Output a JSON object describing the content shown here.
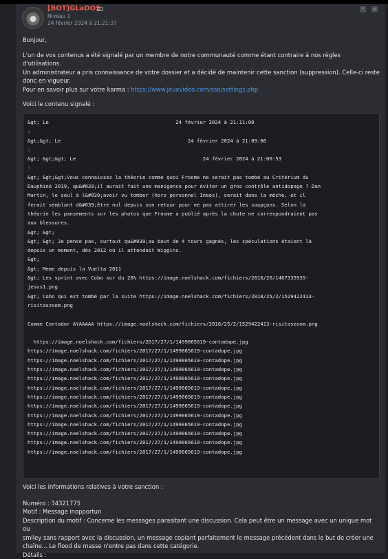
{
  "author": {
    "name": "[BOT]GLaDOS",
    "level": "Niveau 1",
    "date": "24 février 2024 à 21:21:37",
    "avatar_icon": "avatar-image"
  },
  "icons": [
    "mail-icon",
    "quote-icon",
    "options-icon"
  ],
  "message": {
    "greeting": "Bonjour,",
    "para1_line1": "L'un de vos contenus a été signalé par un membre de notre communauté comme étant contraire à nos règles d'utilisations.",
    "para1_line2": "Un administrateur a pris connaissance de votre dossier et a décidé de maintenir cette sanction (suppression). Celle-ci reste",
    "para1_line3": "donc en vigueur.",
    "karma_prefix": "Pour en savoir plus sur votre karma : ",
    "karma_link": "https://www.jeuxvideo.com/sso/settings.php",
    "content_intro": "Voici le contenu signalé :",
    "code_lines": [
      "&gt; Le                                          24 février 2024 à 21:11:00",
      ":",
      "&gt;&gt; Le                                          24 février 2024 à 21:09:00",
      ":",
      "&gt; &gt;&gt; Le                                          24 février 2024 à 21:00:53",
      ":",
      "&gt; &gt;&gt;Vous connaissez la théorie comme quoi Froome ne serait pas tombé au Critérium du",
      "Dauphiné 2019, qu&#039;il aurait fait une manigance pour éviter un gros contrôle antidopage ? Dan",
      "Martin, le seul à l&#039;avoir vu tomber (hors personnel Ineos), serait dans la mèche, et il",
      "ferait semblant d&#039;être nul depuis son retour pour ne pas attirer les soupçons. Selon la",
      "théorie les pansements sur les photos que Froome a publié après la chute ne correspondraient pas",
      "aux blessures.",
      "&gt; &gt;",
      "&gt; &gt; Je pense pas, surtout qu&#039;au bout de 4 tours gagnés, les spéculations étaient là",
      "depuis un moment, dès 2012 où il attendait Wiggins.",
      "&gt;",
      "&gt; Meme depuis la Vuelta 2011",
      "&gt; Les sprint avec Cobo sur du 20% https://image.noelshack.com/fichiers/2016/26/1467335935-",
      "jesus1.png",
      "&gt; Cobo qui est tombé par la suite https://image.noelshack.com/fichiers/2018/25/2/1529422413-",
      "risitaszoom.png",
      "",
      "Comme Contador AYAAAAA https://image.noelshack.com/fichiers/2018/25/2/1529422413-risitaszoom.png",
      "",
      "  https://image.noelshack.com/fichiers/2017/27/1/1499065619-contadope.jpg",
      "https://image.noelshack.com/fichiers/2017/27/1/1499065619-contadope.jpg",
      "https://image.noelshack.com/fichiers/2017/27/1/1499065619-contadope.jpg",
      "https://image.noelshack.com/fichiers/2017/27/1/1499065619-contadope.jpg",
      "https://image.noelshack.com/fichiers/2017/27/1/1499065619-contadope.jpg",
      "https://image.noelshack.com/fichiers/2017/27/1/1499065619-contadope.jpg",
      "https://image.noelshack.com/fichiers/2017/27/1/1499065619-contadope.jpg",
      "https://image.noelshack.com/fichiers/2017/27/1/1499065619-contadope.jpg",
      "https://image.noelshack.com/fichiers/2017/27/1/1499065619-contadope.jpg",
      "https://image.noelshack.com/fichiers/2017/27/1/1499065619-contadope.jpg",
      "https://image.noelshack.com/fichiers/2017/27/1/1499065619-contadope.jpg",
      "https://image.noelshack.com/fichiers/2017/27/1/1499065619-contadope.jpg",
      "https://image.noelshack.com/fichiers/2017/27/1/1499065619-contadope.jpg"
    ],
    "sanction_intro": "Voici les informations relatives à votre sanction :",
    "numero": "Numéro : 34321775",
    "motif": "Motif : Message inopportun",
    "desc_line1": "Description du motif : Concerne les messages parasitant une discussion. Cela peut être un message avec un unique mot ou",
    "desc_line2": "smiley sans rapport avec la discussion, un message copiant parfaitement le message précédent dans le but de créer une",
    "desc_line3": "chaîne... Le flood de masse n'entre pas dans cette catégorie.",
    "details": "Détails :"
  }
}
